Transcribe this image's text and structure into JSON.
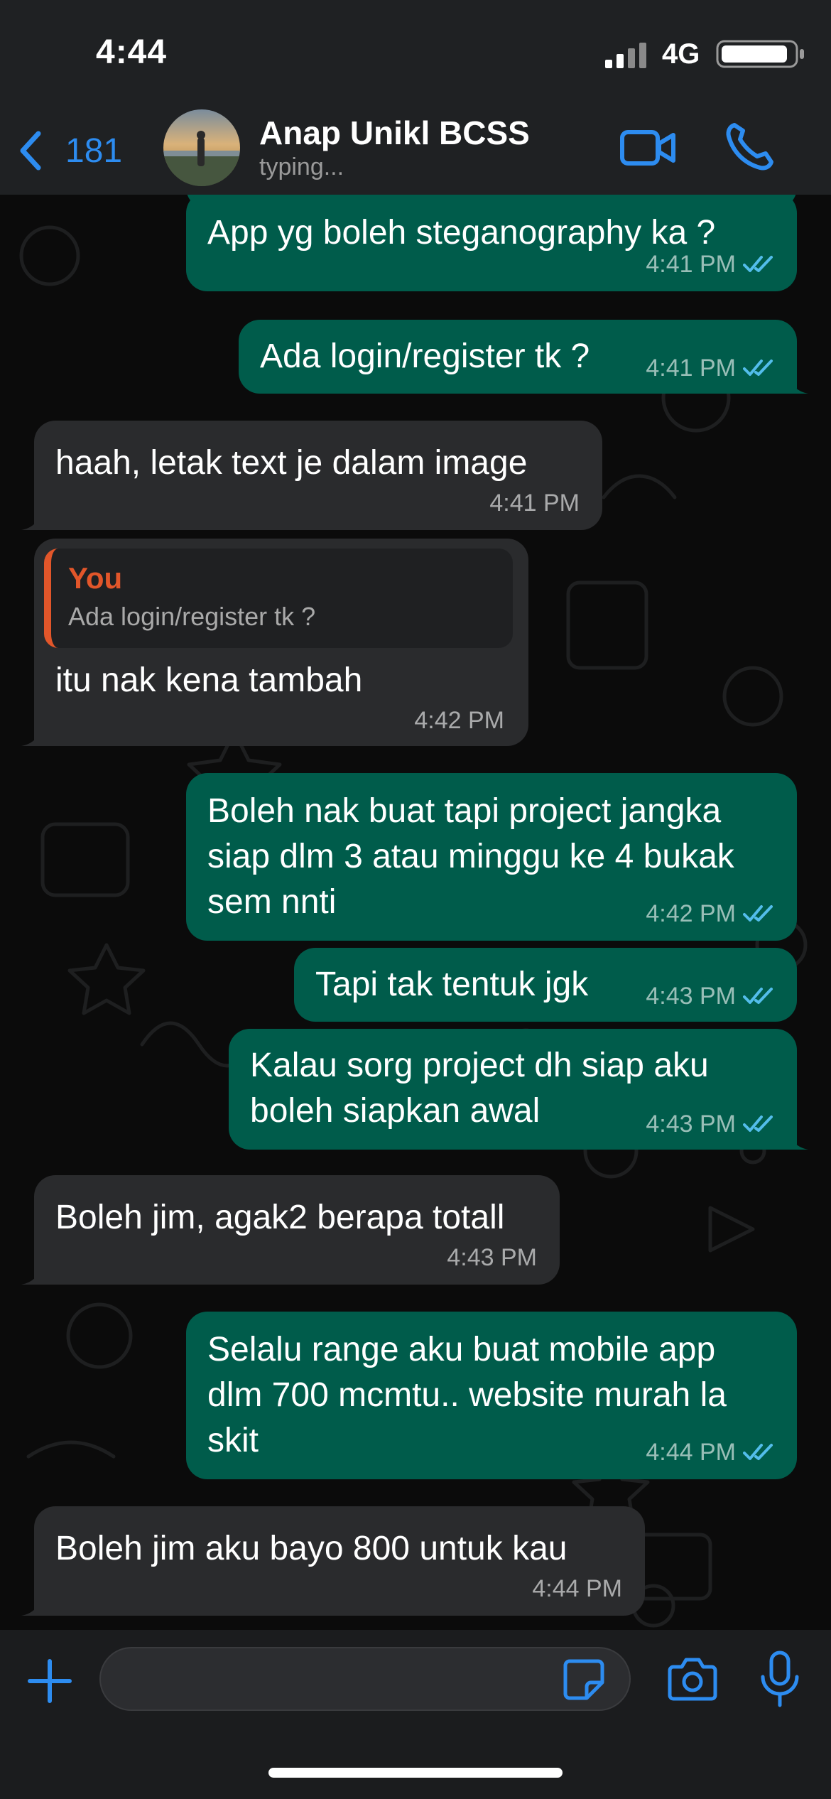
{
  "status_bar": {
    "time": "4:44",
    "network": "4G"
  },
  "header": {
    "back_count": "181",
    "contact_name": "Anap Unikl BCSS",
    "contact_status": "typing..."
  },
  "messages": [
    {
      "direction": "out",
      "text": "App yg boleh steganography ka ?",
      "time": "4:41 PM",
      "read": true
    },
    {
      "direction": "out",
      "text": "Ada login/register tk ?",
      "time": "4:41 PM",
      "read": true
    },
    {
      "direction": "in",
      "text": "haah, letak text je dalam image",
      "time": "4:41 PM"
    },
    {
      "direction": "in",
      "reply_author": "You",
      "reply_text": "Ada login/register tk ?",
      "text": "itu nak kena tambah",
      "time": "4:42 PM"
    },
    {
      "direction": "out",
      "text": "Boleh nak buat tapi project jangka siap dlm 3 atau minggu ke 4 bukak sem nnti",
      "time": "4:42 PM",
      "read": true
    },
    {
      "direction": "out",
      "text": "Tapi tak tentuk jgk",
      "time": "4:43 PM",
      "read": true
    },
    {
      "direction": "out",
      "text": "Kalau sorg project dh siap aku boleh siapkan awal",
      "time": "4:43 PM",
      "read": true
    },
    {
      "direction": "in",
      "text": "Boleh jim, agak2 berapa totall",
      "time": "4:43 PM"
    },
    {
      "direction": "out",
      "text": "Selalu range aku buat mobile app dlm 700 mcmtu.. website murah la skit",
      "time": "4:44 PM",
      "read": true
    },
    {
      "direction": "in",
      "text": "Boleh jim aku bayo 800 untuk kau",
      "time": "4:44 PM"
    }
  ],
  "input": {
    "value": "",
    "placeholder": ""
  },
  "colors": {
    "accent": "#2d8cf0",
    "outgoing_bubble": "#005c4b",
    "incoming_bubble": "#2a2b2d",
    "reply_accent": "#e2562a",
    "read_ticks": "#53bdeb"
  },
  "icons": {
    "back": "chevron-left-icon",
    "video": "video-camera-icon",
    "call": "phone-icon",
    "attach": "plus-icon",
    "sticker": "sticker-icon",
    "camera": "camera-icon",
    "mic": "microphone-icon"
  }
}
